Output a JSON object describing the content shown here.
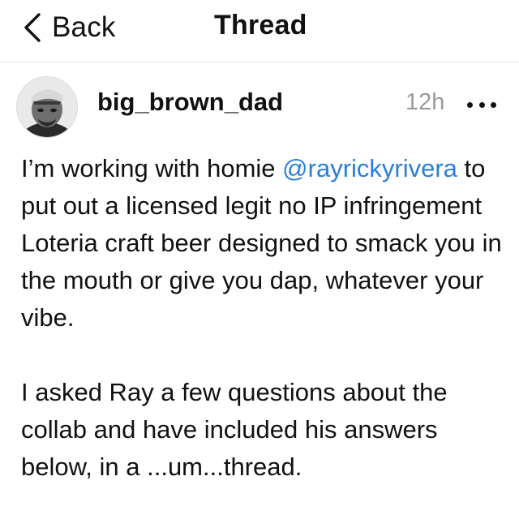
{
  "header": {
    "back_label": "Back",
    "title": "Thread"
  },
  "post": {
    "username": "big_brown_dad",
    "timestamp": "12h",
    "paragraph1": {
      "before_mention": "I’m working with homie ",
      "mention": "@rayrickyrivera",
      "after_mention": " to put out a licensed legit no IP infringement Loteria craft beer designed to smack you in the mouth or give you dap, whatever your vibe."
    },
    "paragraph2": "I asked Ray a few questions about the collab and have included his answers below, in a ...um...thread."
  },
  "colors": {
    "mention": "#2b7fd9",
    "timestamp": "#9a9a9a",
    "divider": "#e3e3e3"
  },
  "icons": {
    "back": "chevron-left-icon",
    "more": "ellipsis-icon",
    "avatar": "user-avatar"
  }
}
